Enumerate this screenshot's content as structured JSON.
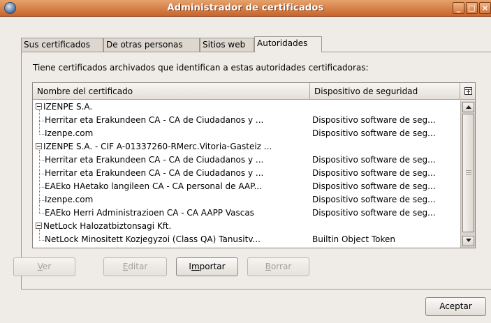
{
  "window": {
    "title": "Administrador de certificados",
    "minimize": "_",
    "maximize": "□",
    "close": "×"
  },
  "tabs": [
    {
      "label": "Sus certificados",
      "active": false
    },
    {
      "label": "De otras personas",
      "active": false
    },
    {
      "label": "Sitios web",
      "active": false
    },
    {
      "label": "Autoridades",
      "active": true
    }
  ],
  "description": "Tiene certificados archivados que identifican a estas autoridades certificadoras:",
  "tree": {
    "columns": {
      "name": "Nombre del certificado",
      "device": "Dispositivo de seguridad"
    },
    "rows": [
      {
        "type": "group",
        "name": "IZENPE S.A.",
        "device": ""
      },
      {
        "type": "child",
        "name": "Herritar eta Erakundeen CA - CA de Ciudadanos y ...",
        "device": "Dispositivo software de seg..."
      },
      {
        "type": "child",
        "name": "Izenpe.com",
        "device": "Dispositivo software de seg..."
      },
      {
        "type": "group",
        "name": "IZENPE S.A. - CIF A-01337260-RMerc.Vitoria-Gasteiz ...",
        "device": ""
      },
      {
        "type": "child",
        "name": "Herritar eta Erakundeen CA - CA de Ciudadanos y ...",
        "device": "Dispositivo software de seg..."
      },
      {
        "type": "child",
        "name": "Herritar eta Erakundeen CA - CA de Ciudadanos y ...",
        "device": "Dispositivo software de seg..."
      },
      {
        "type": "child",
        "name": "EAEko HAetako langileen CA - CA personal de AAP...",
        "device": "Dispositivo software de seg..."
      },
      {
        "type": "child",
        "name": "Izenpe.com",
        "device": "Dispositivo software de seg..."
      },
      {
        "type": "child",
        "name": "EAEko Herri Administrazioen CA - CA AAPP Vascas",
        "device": "Dispositivo software de seg..."
      },
      {
        "type": "group",
        "name": "NetLock Halozatbiztonsagi Kft.",
        "device": ""
      },
      {
        "type": "child",
        "name": "NetLock Minositett Kozjegyzoi (Class QA) Tanusitv...",
        "device": "Builtin Object Token"
      }
    ]
  },
  "buttons": {
    "ver": {
      "mnemonic": "V",
      "rest": "er",
      "enabled": false
    },
    "editar": {
      "mnemonic": "E",
      "rest": "ditar",
      "enabled": false
    },
    "importar": {
      "pre": "I",
      "mnemonic": "m",
      "rest": "portar",
      "enabled": true
    },
    "borrar": {
      "mnemonic": "B",
      "rest": "orrar",
      "enabled": false
    },
    "aceptar": {
      "label": "Aceptar",
      "enabled": true
    }
  }
}
